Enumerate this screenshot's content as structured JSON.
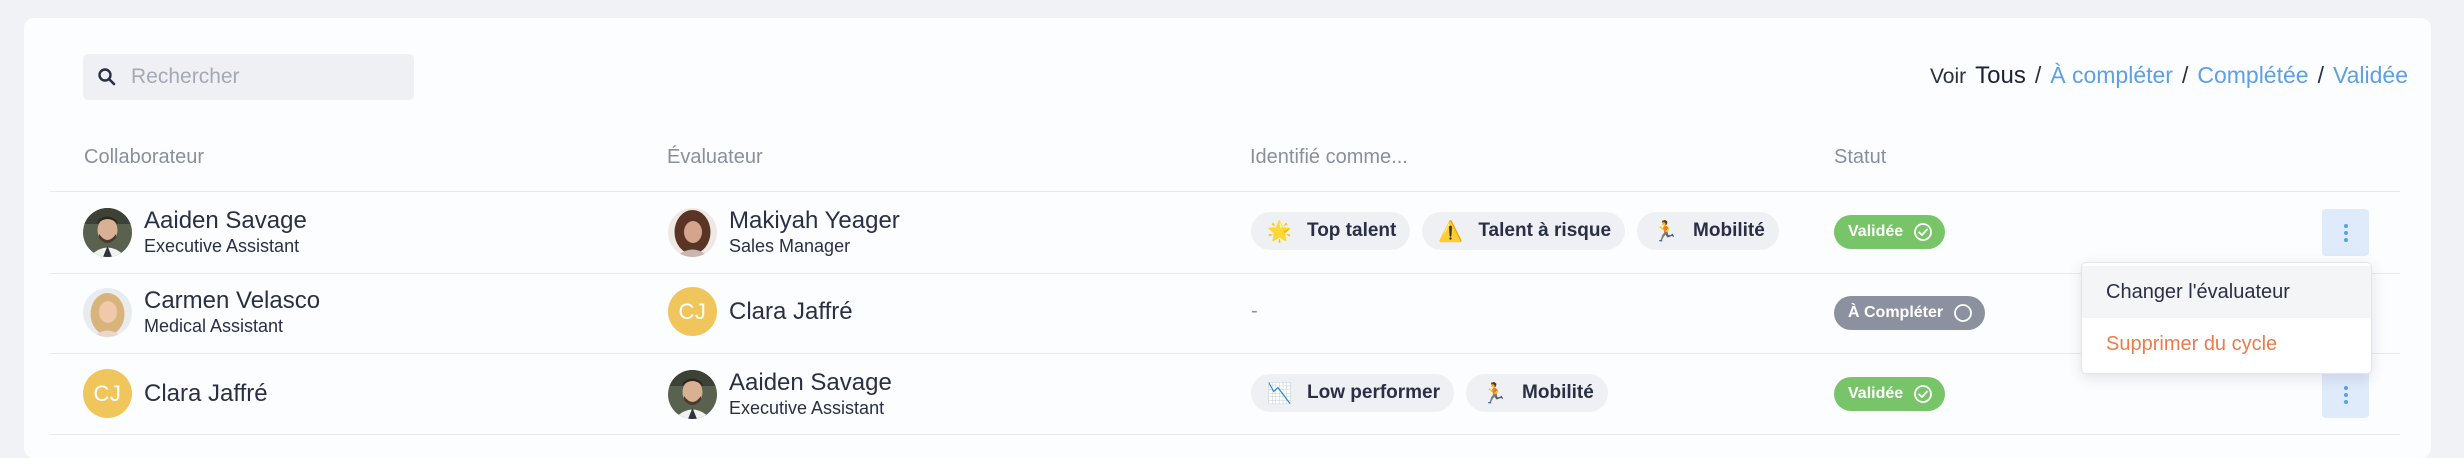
{
  "search": {
    "placeholder": "Rechercher"
  },
  "filters": {
    "voir_label": "Voir",
    "active": "Tous",
    "links": [
      "À compléter",
      "Complétée",
      "Validée"
    ]
  },
  "columns": {
    "collaborateur": "Collaborateur",
    "evaluateur": "Évaluateur",
    "identifie": "Identifié comme...",
    "statut": "Statut"
  },
  "rows": [
    {
      "collaborateur": {
        "name": "Aaiden Savage",
        "role": "Executive Assistant",
        "avatar": "photo-man-beard"
      },
      "evaluateur": {
        "name": "Makiyah Yeager",
        "role": "Sales Manager",
        "avatar": "photo-woman-curly"
      },
      "tags": [
        {
          "icon": "🌟",
          "label": "Top talent"
        },
        {
          "icon": "⚠️",
          "label": "Talent à risque"
        },
        {
          "icon": "🏃",
          "label": "Mobilité"
        }
      ],
      "status": {
        "label": "Validée",
        "kind": "valid"
      }
    },
    {
      "collaborateur": {
        "name": "Carmen Velasco",
        "role": "Medical Assistant",
        "avatar": "photo-woman-blonde"
      },
      "evaluateur": {
        "name": "Clara Jaffré",
        "initials": "CJ"
      },
      "tags_empty": "-",
      "status": {
        "label": "À Compléter",
        "kind": "todo"
      }
    },
    {
      "collaborateur": {
        "name": "Clara Jaffré",
        "initials": "CJ"
      },
      "evaluateur": {
        "name": "Aaiden Savage",
        "role": "Executive Assistant",
        "avatar": "photo-man-beard"
      },
      "tags": [
        {
          "icon": "📉",
          "label": "Low performer"
        },
        {
          "icon": "🏃",
          "label": "Mobilité"
        }
      ],
      "status": {
        "label": "Validée",
        "kind": "valid"
      }
    }
  ],
  "context_menu": {
    "items": [
      "Changer l'évaluateur",
      "Supprimer du cycle"
    ]
  },
  "colors": {
    "link": "#5da0e3",
    "valid": "#77c568",
    "todo": "#8c919f",
    "danger": "#ec7a4b",
    "initials_bg": "#f0c55c"
  }
}
